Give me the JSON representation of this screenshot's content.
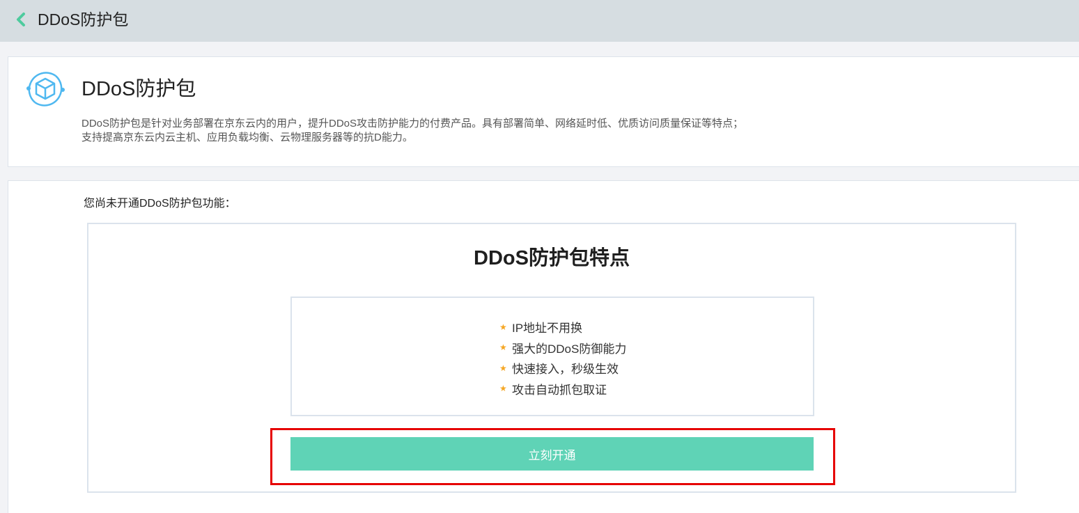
{
  "header": {
    "back_icon": "chevron-left-icon",
    "title": "DDoS防护包"
  },
  "intro": {
    "icon": "cube-cycle-icon",
    "title": "DDoS防护包",
    "description_line1": "DDoS防护包是针对业务部署在京东云内的用户，提升DDoS攻击防护能力的付费产品。具有部署简单、网络延时低、优质访问质量保证等特点；",
    "description_line2": "支持提高京东云内云主机、应用负载均衡、云物理服务器等的抗D能力。"
  },
  "main": {
    "not_open_text": "您尚未开通DDoS防护包功能：",
    "features_title": "DDoS防护包特点",
    "features": [
      {
        "label": "IP地址不用换",
        "icon": "star-icon"
      },
      {
        "label": "强大的DDoS防御能力",
        "icon": "star-icon"
      },
      {
        "label": "快速接入，秒级生效",
        "icon": "star-icon"
      },
      {
        "label": "攻击自动抓包取证",
        "icon": "star-icon"
      }
    ],
    "open_button_label": "立刻开通"
  },
  "colors": {
    "accent": "#5fd3b6",
    "star": "#f5a623",
    "highlight": "#e60000",
    "header_bg": "#d6dde1",
    "icon_blue": "#4fb8f0"
  }
}
